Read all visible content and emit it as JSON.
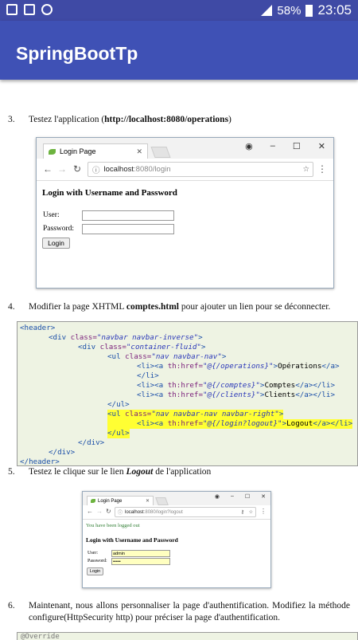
{
  "status": {
    "battery": "58%",
    "time": "23:05"
  },
  "appbar": {
    "title": "SpringBootTp"
  },
  "step3": {
    "num": "3.",
    "pre": "Testez l'application (",
    "url": "http://localhost:8080/operations",
    "post": ")"
  },
  "shot1": {
    "tab": "Login Page",
    "url_host": "localhost",
    "url_path": ":8080/login",
    "heading": "Login with Username and Password",
    "user_label": "User:",
    "password_label": "Password:",
    "login_button": "Login"
  },
  "step4": {
    "num": "4.",
    "pre": "Modifier la page XHTML ",
    "bold": "comptes.html",
    "post": " pour ajouter un lien pour se déconnecter."
  },
  "code_lines": [
    "<header>",
    "<div class=\"navbar navbar-inverse\">",
    "<div class=\"container-fluid\">",
    "<ul class=\"nav navbar-nav\">",
    "<li><a th:href=\"@{/operations}\">Opérations</a>",
    "</li>",
    "<li><a th:href=\"@{/comptes}\">Comptes</a></li>",
    "<li><a th:href=\"@{/clients}\">Clients</a></li>",
    "</ul>",
    "<ul class=\"nav navbar-nav navbar-right\">",
    "<li><a th:href=\"@{/login?logout}\">Logout</a></li>",
    "</ul>",
    "</div>",
    "</div>",
    "</header>"
  ],
  "step5": {
    "num": "5.",
    "pre": "Testez le clique sur le lien ",
    "bold": "Logout",
    "post": " de l'application"
  },
  "shot2": {
    "tab": "Login Page",
    "url_host": "localhost",
    "url_path": ":8080/login?logout",
    "logged_out": "You have been logged out",
    "heading": "Login with Username and Password",
    "user_label": "User:",
    "user_value": "admin",
    "password_label": "Password:",
    "password_value": "•••••",
    "login_button": "Login"
  },
  "step6": {
    "num": "6.",
    "text": "Maintenant, nous allons personnaliser la page d'authentification. Modifiez la méthode configure(HttpSecurity http) pour préciser la page d'authentification."
  },
  "code2": {
    "first": "@Override"
  },
  "colors": {
    "appbar": "#3f51b5",
    "statusbar": "#3f4aa5",
    "code_bg": "#eef3e3",
    "highlight": "#ffff33"
  }
}
